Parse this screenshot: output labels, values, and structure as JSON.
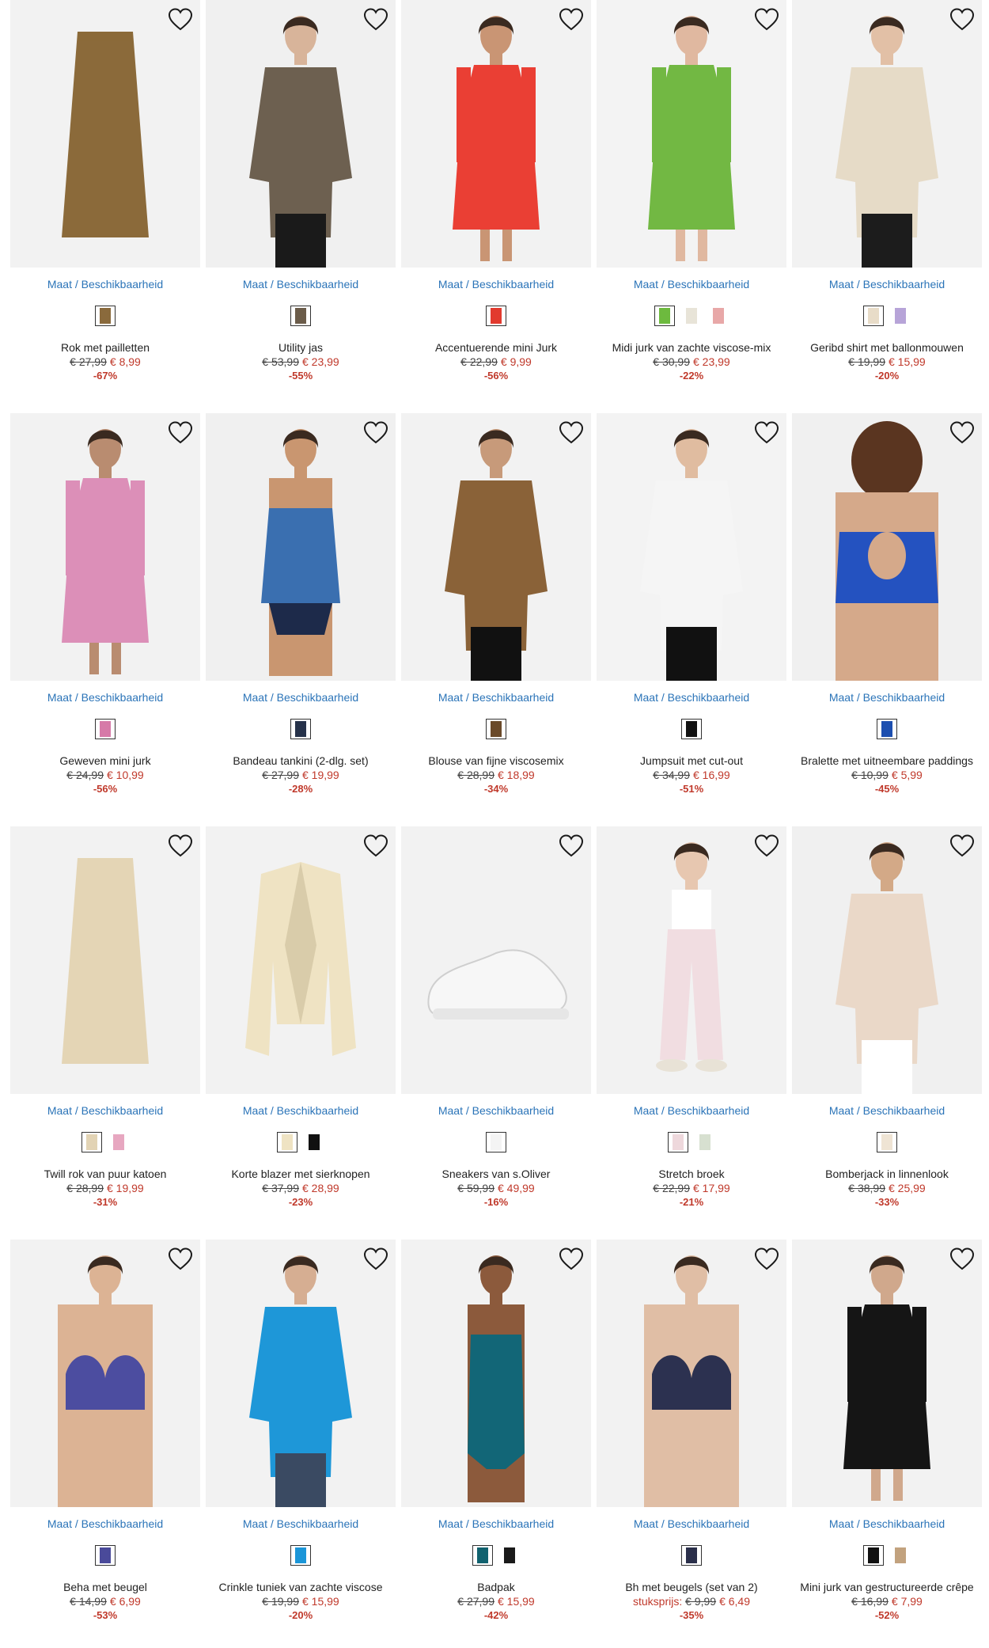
{
  "ui": {
    "availability_label": "Maat / Beschikbaarheid"
  },
  "colors": {
    "link": "#2b74b8",
    "sale": "#c0392b",
    "image_bg": "#f2f2f2"
  },
  "products": [
    {
      "title": "Rok met pailletten",
      "old_price": "€ 27,99",
      "price": "€ 8,99",
      "discount": "-67%",
      "swatches": [
        "#8a6a3c"
      ],
      "bg": "#f2f2f2",
      "figure": "skirt",
      "main": "#8b6a3a"
    },
    {
      "title": "Utility jas",
      "old_price": "€ 53,99",
      "price": "€ 23,99",
      "discount": "-55%",
      "swatches": [
        "#6b5c4a"
      ],
      "bg": "#f0f0f0",
      "figure": "model",
      "main": "#6d6050",
      "accent": "#1a1a1a",
      "skin": "#d8b49a"
    },
    {
      "title": "Accentuerende mini Jurk",
      "old_price": "€ 22,99",
      "price": "€ 9,99",
      "discount": "-56%",
      "swatches": [
        "#e23a2e"
      ],
      "bg": "#f2f2f2",
      "figure": "dress",
      "main": "#ea3f34",
      "skin": "#c99574"
    },
    {
      "title": "Midi jurk van zachte viscose-mix",
      "old_price": "€ 30,99",
      "price": "€ 23,99",
      "discount": "-22%",
      "swatches": [
        "#6dba3e",
        "#e8e4d8",
        "#e8a8a8"
      ],
      "bg": "#f3f3f3",
      "figure": "dress",
      "main": "#72b843",
      "skin": "#e0b8a0"
    },
    {
      "title": "Geribd shirt met ballonmouwen",
      "old_price": "€ 19,99",
      "price": "€ 15,99",
      "discount": "-20%",
      "swatches": [
        "#e8dcc8",
        "#b7a4d8"
      ],
      "bg": "#f2f2f2",
      "figure": "model",
      "main": "#e6dbc7",
      "accent": "#1c1c1c",
      "skin": "#e2c0a6"
    },
    {
      "title": "Geweven mini jurk",
      "old_price": "€ 24,99",
      "price": "€ 10,99",
      "discount": "-56%",
      "swatches": [
        "#d67aa8"
      ],
      "bg": "#f2f2f2",
      "figure": "dress",
      "main": "#dc8fb8",
      "skin": "#b98c70"
    },
    {
      "title": "Bandeau tankini (2-dlg. set)",
      "old_price": "€ 27,99",
      "price": "€ 19,99",
      "discount": "-28%",
      "swatches": [
        "#26324a"
      ],
      "bg": "#f0f0f0",
      "figure": "swim",
      "main": "#3a6fb0",
      "accent": "#1d2a4a",
      "skin": "#c99670"
    },
    {
      "title": "Blouse van fijne viscosemix",
      "old_price": "€ 28,99",
      "price": "€ 18,99",
      "discount": "-34%",
      "swatches": [
        "#6a4a2a"
      ],
      "bg": "#f2f2f2",
      "figure": "model",
      "main": "#8a6238",
      "accent": "#111111",
      "skin": "#c79a7a"
    },
    {
      "title": "Jumpsuit met cut-out",
      "old_price": "€ 34,99",
      "price": "€ 16,99",
      "discount": "-51%",
      "swatches": [
        "#111111"
      ],
      "bg": "#f3f3f3",
      "figure": "model",
      "main": "#f5f5f5",
      "accent": "#111111",
      "skin": "#e0bca0"
    },
    {
      "title": "Bralette met uitneembare paddings",
      "old_price": "€ 10,99",
      "price": "€ 5,99",
      "discount": "-45%",
      "swatches": [
        "#1d4fb0"
      ],
      "bg": "#f0f0f0",
      "figure": "back",
      "main": "#2452c0",
      "skin": "#d5a98a"
    },
    {
      "title": "Twill rok van puur katoen",
      "old_price": "€ 28,99",
      "price": "€ 19,99",
      "discount": "-31%",
      "swatches": [
        "#e2d3b4",
        "#e7a7c0"
      ],
      "bg": "#f2f2f2",
      "figure": "skirt",
      "main": "#e4d5b5"
    },
    {
      "title": "Korte blazer met sierknopen",
      "old_price": "€ 37,99",
      "price": "€ 28,99",
      "discount": "-23%",
      "swatches": [
        "#efe3c3",
        "#111111"
      ],
      "bg": "#f2f2f2",
      "figure": "blazer",
      "main": "#efe3c3"
    },
    {
      "title": "Sneakers van s.Oliver",
      "old_price": "€ 59,99",
      "price": "€ 49,99",
      "discount": "-16%",
      "swatches": [
        "#f4f4f4"
      ],
      "bg": "#f2f2f2",
      "figure": "shoe",
      "main": "#f7f7f7"
    },
    {
      "title": "Stretch broek",
      "old_price": "€ 22,99",
      "price": "€ 17,99",
      "discount": "-21%",
      "swatches": [
        "#eed8dc",
        "#d7e0d0"
      ],
      "bg": "#f2f2f2",
      "figure": "pants",
      "main": "#f1dde1",
      "skin": "#e7c7b0"
    },
    {
      "title": "Bomberjack in linnenlook",
      "old_price": "€ 38,99",
      "price": "€ 25,99",
      "discount": "-33%",
      "swatches": [
        "#efe4d4"
      ],
      "bg": "#f0f0f0",
      "figure": "model",
      "main": "#ead8c8",
      "accent": "#ffffff",
      "skin": "#d3a987"
    },
    {
      "title": "Beha met beugel",
      "old_price": "€ 14,99",
      "price": "€ 6,99",
      "discount": "-53%",
      "swatches": [
        "#4a4a9a"
      ],
      "bg": "#f2f2f2",
      "figure": "bra",
      "main": "#4c4da0",
      "skin": "#dcb394"
    },
    {
      "title": "Crinkle tuniek van zachte viscose",
      "old_price": "€ 19,99",
      "price": "€ 15,99",
      "discount": "-20%",
      "swatches": [
        "#1b96d8"
      ],
      "bg": "#f2f2f2",
      "figure": "model",
      "main": "#1e97d8",
      "accent": "#3a4a62",
      "skin": "#d6ae92"
    },
    {
      "title": "Badpak",
      "old_price": "€ 27,99",
      "price": "€ 15,99",
      "discount": "-42%",
      "swatches": [
        "#11626f",
        "#1a1a1a"
      ],
      "bg": "#f2f2f2",
      "figure": "swimsuit",
      "main": "#126677",
      "skin": "#8c5a3c"
    },
    {
      "title": "Bh met beugels (set van 2)",
      "prefix": "stuksprijs:",
      "old_price": "€ 9,99",
      "price": "€ 6,49",
      "discount": "-35%",
      "swatches": [
        "#2a2f4a"
      ],
      "bg": "#f2f2f2",
      "figure": "bra",
      "main": "#2c3150",
      "skin": "#e0bea5"
    },
    {
      "title": "Mini jurk van gestructureerde crêpe",
      "old_price": "€ 16,99",
      "price": "€ 7,99",
      "discount": "-52%",
      "swatches": [
        "#111111",
        "#c2a27e"
      ],
      "bg": "#f2f2f2",
      "figure": "dress",
      "main": "#151515",
      "skin": "#d0a88c"
    }
  ]
}
